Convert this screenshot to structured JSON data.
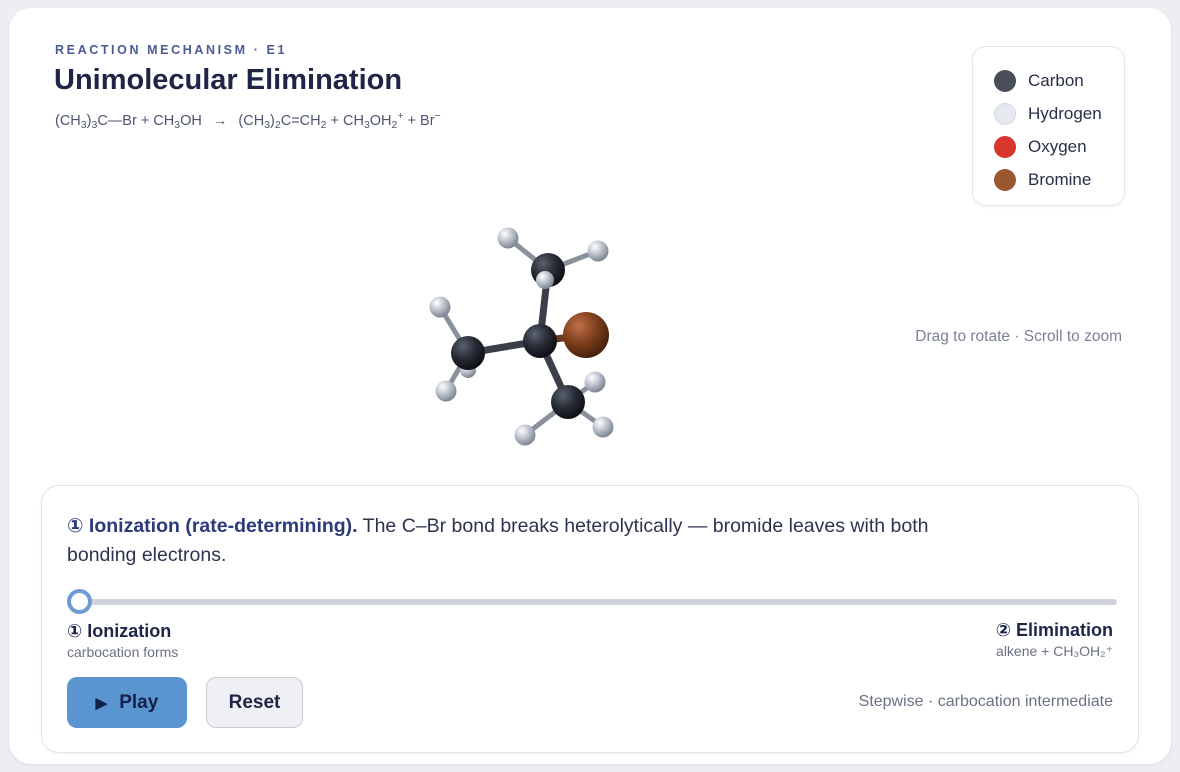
{
  "header": {
    "eyebrow": "REACTION MECHANISM · E1",
    "title": "Unimolecular Elimination",
    "equation": {
      "reactant_1": [
        "(CH",
        "3",
        ")",
        "3",
        "C—Br + CH",
        "3",
        "OH"
      ],
      "arrow": "→",
      "products": [
        "(CH",
        "3",
        ")",
        "2",
        "C=CH",
        "2",
        " + CH",
        "3",
        "OH",
        "2",
        "+",
        " + Br",
        "−"
      ]
    }
  },
  "legend": {
    "items": [
      {
        "label": "Carbon",
        "color": "#4a4e5a"
      },
      {
        "label": "Hydrogen",
        "color": "#e6e9f0"
      },
      {
        "label": "Oxygen",
        "color": "#d8352d"
      },
      {
        "label": "Bromine",
        "color": "#9a5730"
      }
    ]
  },
  "viewer": {
    "hint": "Drag to rotate · Scroll to zoom"
  },
  "step": {
    "title": "① Ionization (rate-determining).",
    "body": " The C–Br bond breaks heterolytically — bromide leaves with both bonding electrons."
  },
  "slider": {
    "value": 0,
    "start_title": "① Ionization",
    "start_sub": "carbocation forms",
    "end_title": "② Elimination",
    "end_sub": "alkene + CH₃OH₂⁺"
  },
  "controls": {
    "play_icon": "▶",
    "play_label": "Play",
    "reset_label": "Reset",
    "note": "Stepwise · carbocation intermediate"
  }
}
